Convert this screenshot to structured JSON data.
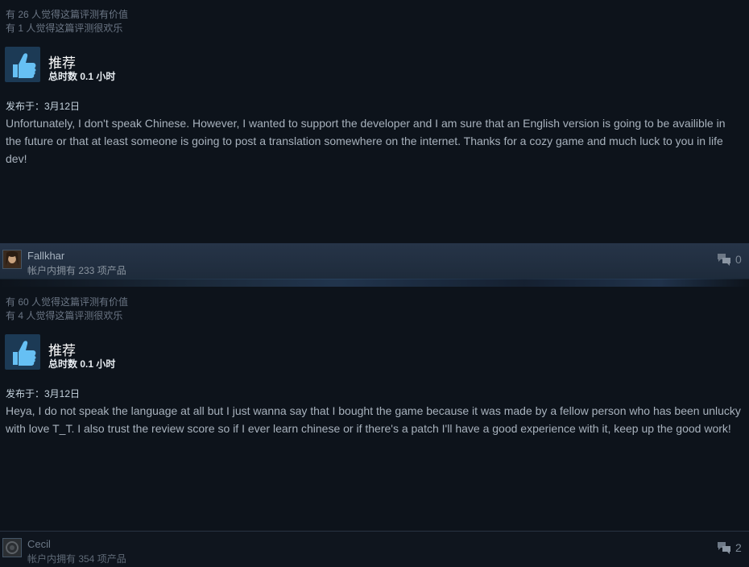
{
  "reviews": [
    {
      "helpful": "有 26 人觉得这篇评测有价值",
      "funny": "有 1 人觉得这篇评测很欢乐",
      "verdict": "推荐",
      "hours": "总时数 0.1 小时",
      "posted": "发布于：3月12日",
      "text": "Unfortunately, I don't speak Chinese. However, I wanted to support the developer and I am sure that an English version is going to be availible in the future or that at least someone is going to post a translation somewhere on the internet. Thanks for a cozy game and much luck to you in life dev!",
      "author": "Fallkhar",
      "products": "帐户内拥有 233 项产品",
      "comments": "0"
    },
    {
      "helpful": "有 60 人觉得这篇评测有价值",
      "funny": "有 4 人觉得这篇评测很欢乐",
      "verdict": "推荐",
      "hours": "总时数 0.1 小时",
      "posted": "发布于：3月12日",
      "text": "Heya, I do not speak the language at all but I just wanna say that I bought the game because it was made by a fellow person who has been unlucky with love T_T. I also trust the review score so if I ever learn chinese or if there's a patch I'll have a good experience with it, keep up the good work!",
      "author": "Cecil",
      "products": "帐户内拥有 354 项产品",
      "comments": "2"
    }
  ],
  "colors": {
    "background": "#0d131b",
    "accent": "#4d88b5",
    "thumb_up": "#66c0f4"
  },
  "icons": {
    "thumb": "thumbs-up-icon",
    "comment": "comment-bubbles-icon"
  }
}
